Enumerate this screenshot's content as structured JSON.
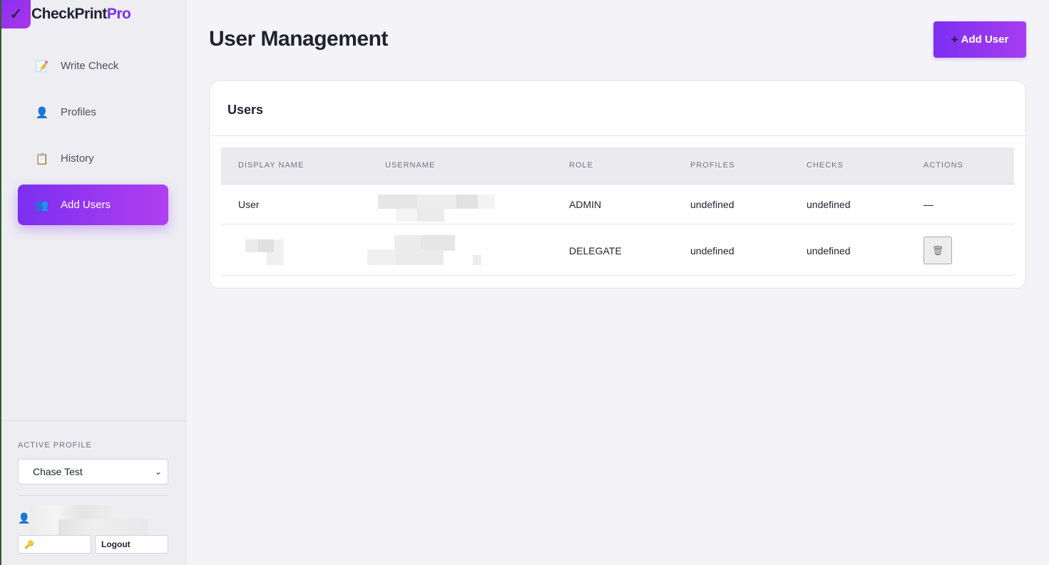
{
  "brand": {
    "icon": "check-icon",
    "check_glyph": "✓",
    "name_a": "CheckPrint",
    "name_b": "Pro"
  },
  "sidebar": {
    "items": [
      {
        "label": "Write Check",
        "icon": "memo-icon",
        "glyph": "📝",
        "active": false
      },
      {
        "label": "Profiles",
        "icon": "user-icon",
        "glyph": "👤",
        "active": false
      },
      {
        "label": "History",
        "icon": "clipboard-icon",
        "glyph": "📋",
        "active": false
      },
      {
        "label": "Add Users",
        "icon": "users-icon",
        "glyph": "👥",
        "active": true
      }
    ],
    "active_profile_label": "ACTIVE PROFILE",
    "active_profile_value": "Chase Test",
    "user_icon": "👤",
    "key_icon": "🔑",
    "logout_label": "Logout"
  },
  "main": {
    "title": "User Management",
    "add_user_plus": "+",
    "add_user_label": "Add User",
    "card_title": "Users",
    "table": {
      "headers": [
        "DISPLAY NAME",
        "USERNAME",
        "ROLE",
        "PROFILES",
        "CHECKS",
        "ACTIONS"
      ],
      "rows": [
        {
          "display_name": "User",
          "role": "ADMIN",
          "profiles": "undefined",
          "checks": "undefined",
          "action": "—"
        },
        {
          "display_name": "",
          "role": "DELEGATE",
          "profiles": "undefined",
          "checks": "undefined",
          "action_icon": "trash-icon",
          "action_glyph": "🗑"
        }
      ]
    }
  },
  "colors": {
    "accent": "#7b2ff0",
    "accent_end": "#b13ff0",
    "page_bg": "#f4f4f8",
    "sidebar_bg": "#ededf2"
  }
}
